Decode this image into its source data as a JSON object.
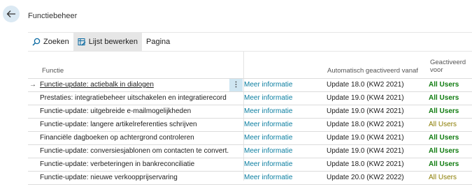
{
  "header": {
    "title": "Functiebeheer"
  },
  "toolbar": {
    "search_label": "Zoeken",
    "edit_list_label": "Lijst bewerken",
    "page_label": "Pagina"
  },
  "columns": {
    "function": "Functie",
    "auto_enabled": "Automatisch geactiveerd vanaf",
    "enabled_for_line1": "Geactiveerd",
    "enabled_for_line2": "voor"
  },
  "rows": [
    {
      "function": "Functie-update: actiebalk in dialogen",
      "more": "Meer informatie",
      "update": "Update 18.0 (KW2 2021)",
      "users": "All Users"
    },
    {
      "function": "Prestaties: integratiebeheer uitschakelen en integratierecord ...",
      "more": "Meer informatie",
      "update": "Update 19.0 (KW4 2021)",
      "users": "All Users"
    },
    {
      "function": "Functie-update: uitgebreide e-mailmogelijkheden",
      "more": "Meer informatie",
      "update": "Update 19.0 (KW4 2021)",
      "users": "All Users"
    },
    {
      "function": "Functie-update: langere artikelreferenties schrijven",
      "more": "Meer informatie",
      "update": "Update 18.0 (KW2 2021)",
      "users": "All Users"
    },
    {
      "function": "Financiële dagboeken op achtergrond controleren",
      "more": "Meer informatie",
      "update": "Update 19.0 (KW4 2021)",
      "users": "All Users"
    },
    {
      "function": "Functie-update: conversiesjablonen om contacten te convert...",
      "more": "Meer informatie",
      "update": "Update 19.0 (KW4 2021)",
      "users": "All Users"
    },
    {
      "function": "Functie-update: verbeteringen in bankreconciliatie",
      "more": "Meer informatie",
      "update": "Update 18.0 (KW2 2021)",
      "users": "All Users"
    },
    {
      "function": "Functie-update: nieuwe verkoopprijservaring",
      "more": "Meer informatie",
      "update": "Update 20.0 (KW2 2022)",
      "users": "All Users"
    }
  ],
  "row_markers": {
    "arrow": "→",
    "dots": "⋮"
  },
  "colors": {
    "link": "#0b7ea0",
    "users_bold": "#107c10",
    "users_plain": "#8a7c00",
    "selected_cell": "#cfe6f2"
  },
  "icons": {
    "back": "back-arrow-icon",
    "search": "search-icon",
    "edit_list": "edit-list-icon"
  }
}
